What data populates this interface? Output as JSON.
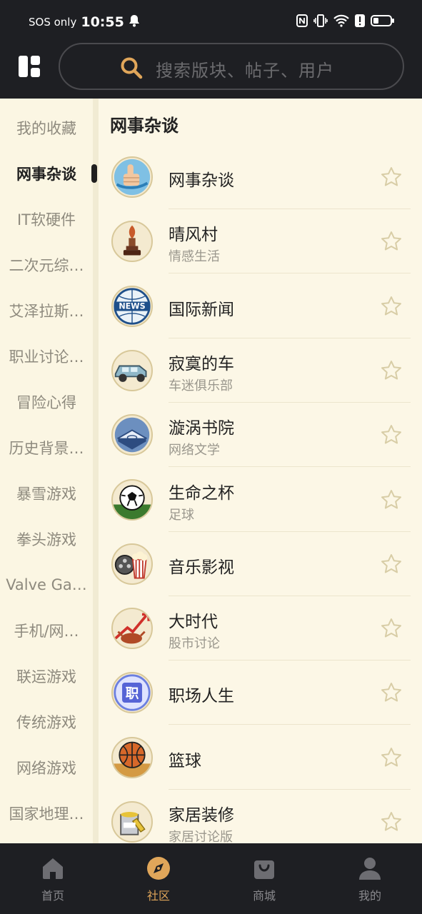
{
  "status_bar": {
    "carrier": "SOS only",
    "time": "10:55"
  },
  "header": {
    "layout_icon": "grid-layout-icon",
    "search_placeholder": "搜索版块、帖子、用户"
  },
  "sidebar": {
    "items": [
      {
        "label": "我的收藏"
      },
      {
        "label": "网事杂谈"
      },
      {
        "label": "IT软硬件"
      },
      {
        "label": "二次元综…"
      },
      {
        "label": "艾泽拉斯…"
      },
      {
        "label": "职业讨论…"
      },
      {
        "label": "冒险心得"
      },
      {
        "label": "历史背景…"
      },
      {
        "label": "暴雪游戏"
      },
      {
        "label": "拳头游戏"
      },
      {
        "label": "Valve Ga…"
      },
      {
        "label": "手机/网…"
      },
      {
        "label": "联运游戏"
      },
      {
        "label": "传统游戏"
      },
      {
        "label": "网络游戏"
      },
      {
        "label": "国家地理…"
      }
    ],
    "active_index": 1
  },
  "main": {
    "section_title": "网事杂谈",
    "forums": [
      {
        "name": "网事杂谈",
        "sub": "",
        "icon": "thumbs-up-icon"
      },
      {
        "name": "晴风村",
        "sub": "情感生活",
        "icon": "trophy-icon"
      },
      {
        "name": "国际新闻",
        "sub": "",
        "icon": "news-globe-icon"
      },
      {
        "name": "寂寞的车",
        "sub": "车迷俱乐部",
        "icon": "car-icon"
      },
      {
        "name": "漩涡书院",
        "sub": "网络文学",
        "icon": "book-icon"
      },
      {
        "name": "生命之杯",
        "sub": "足球",
        "icon": "soccer-ball-icon"
      },
      {
        "name": "音乐影视",
        "sub": "",
        "icon": "popcorn-film-icon"
      },
      {
        "name": "大时代",
        "sub": "股市讨论",
        "icon": "bull-chart-icon"
      },
      {
        "name": "职场人生",
        "sub": "",
        "icon": "job-badge-icon"
      },
      {
        "name": "篮球",
        "sub": "",
        "icon": "basketball-icon"
      },
      {
        "name": "家居装修",
        "sub": "家居讨论版",
        "icon": "paint-bucket-icon"
      }
    ]
  },
  "tabbar": {
    "tabs": [
      {
        "label": "首页",
        "icon": "home-icon"
      },
      {
        "label": "社区",
        "icon": "compass-icon"
      },
      {
        "label": "商城",
        "icon": "shopping-bag-icon"
      },
      {
        "label": "我的",
        "icon": "profile-icon"
      }
    ],
    "active_index": 1
  },
  "colors": {
    "accent": "#e0a65a",
    "dark_bar": "#1e1f23",
    "background": "#fbf6e3"
  }
}
